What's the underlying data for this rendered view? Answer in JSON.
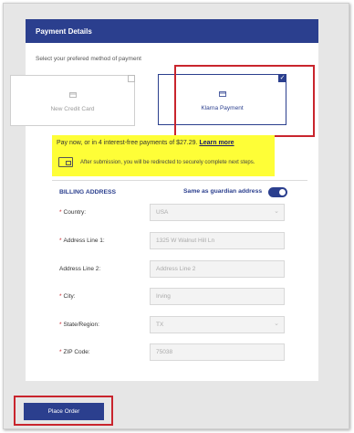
{
  "header": {
    "title": "Payment Details"
  },
  "payment": {
    "prompt": "Select your prefered method of payment",
    "methods": [
      {
        "label": "New Credit Card",
        "selected": false
      },
      {
        "label": "Klarna Payment",
        "selected": true
      }
    ],
    "checkmark": "✓"
  },
  "promo": {
    "text": "Pay now, or in 4 interest-free payments of $27.29.",
    "link": "Learn more",
    "note": "After submission, you will be redirected to securely complete next steps."
  },
  "billing": {
    "title": "BILLING ADDRESS",
    "same_as_label": "Same as guardian address",
    "same_as_enabled": true,
    "fields": [
      {
        "label": "Country:",
        "value": "USA",
        "required": true,
        "dropdown": true
      },
      {
        "label": "Address Line 1:",
        "value": "1325 W Walnut Hill Ln",
        "required": true,
        "dropdown": false
      },
      {
        "label": "Address Line 2:",
        "placeholder": "Address Line 2",
        "required": false,
        "dropdown": false
      },
      {
        "label": "City:",
        "value": "Irving",
        "required": true,
        "dropdown": false
      },
      {
        "label": "State/Region:",
        "value": "TX",
        "required": true,
        "dropdown": true
      },
      {
        "label": "ZIP Code:",
        "value": "75038",
        "required": true,
        "dropdown": false
      }
    ],
    "required_marker": "*",
    "chevron": "⌄"
  },
  "actions": {
    "place_order": "Place Order"
  },
  "colors": {
    "brand": "#2b3f8e",
    "highlight": "#fefe37",
    "annotation": "#c9252d"
  },
  "icons": [
    "card-icon",
    "klarna-icon",
    "check-icon",
    "wallet-icon",
    "chevron-down-icon"
  ]
}
